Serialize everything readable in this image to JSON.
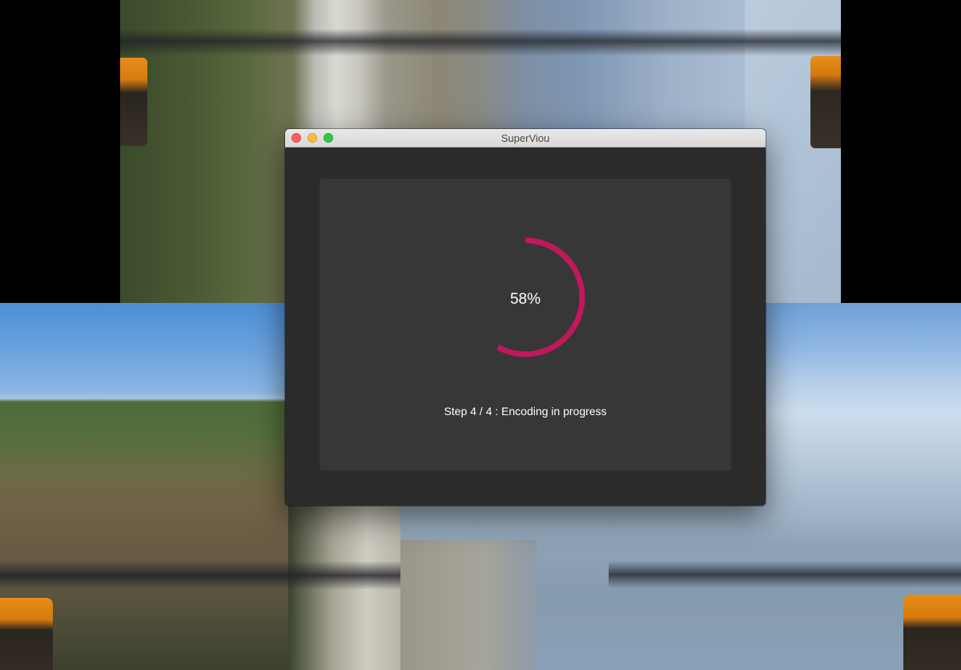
{
  "window": {
    "title": "SuperViou"
  },
  "progress": {
    "percent": 58,
    "label": "58%",
    "status": "Step 4 / 4 : Encoding in progress"
  },
  "colors": {
    "ring": "#c2185b",
    "window_bg": "#2b2b2b",
    "panel_bg": "#373737"
  },
  "icons": {
    "close": "traffic-light-close",
    "minimize": "traffic-light-minimize",
    "maximize": "traffic-light-zoom"
  }
}
